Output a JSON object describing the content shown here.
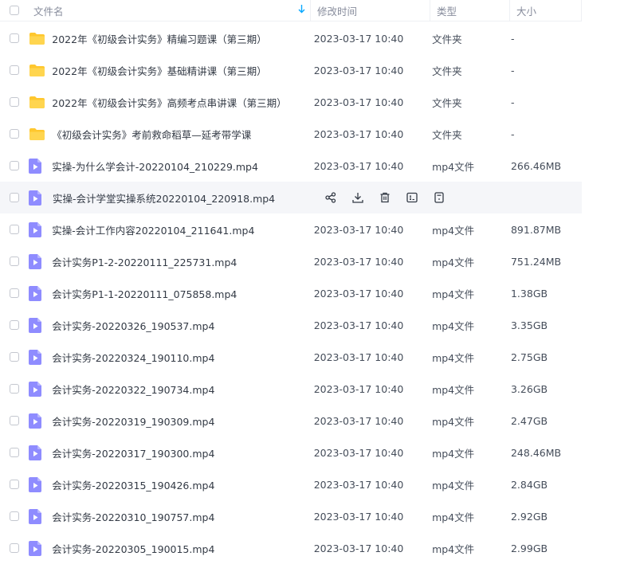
{
  "header": {
    "name": "文件名",
    "sort_icon": "sort-down-arrow-icon",
    "time": "修改时间",
    "type": "类型",
    "size": "大小"
  },
  "colors": {
    "accent": "#06a7ff",
    "folder": "#ffc72e",
    "video": "#8f8cff",
    "hover_bg": "#f5f6f9"
  },
  "rows": [
    {
      "kind": "folder",
      "name": "2022年《初级会计实务》精编习题课（第三期）",
      "time": "2023-03-17 10:40",
      "type": "文件夹",
      "size": "-"
    },
    {
      "kind": "folder",
      "name": "2022年《初级会计实务》基础精讲课（第三期）",
      "time": "2023-03-17 10:40",
      "type": "文件夹",
      "size": "-"
    },
    {
      "kind": "folder",
      "name": "2022年《初级会计实务》高频考点串讲课（第三期）",
      "time": "2023-03-17 10:40",
      "type": "文件夹",
      "size": "-"
    },
    {
      "kind": "folder",
      "name": "《初级会计实务》考前救命稻草—延考带学课",
      "time": "2023-03-17 10:40",
      "type": "文件夹",
      "size": "-"
    },
    {
      "kind": "video",
      "name": "实操-为什么学会计-20220104_210229.mp4",
      "time": "2023-03-17 10:40",
      "type": "mp4文件",
      "size": "266.46MB"
    },
    {
      "kind": "video",
      "name": "实操-会计学堂实操系统20220104_220918.mp4",
      "hover": true,
      "actions": [
        "share-icon",
        "download-icon",
        "delete-icon",
        "rename-icon",
        "more-icon"
      ]
    },
    {
      "kind": "video",
      "name": "实操-会计工作内容20220104_211641.mp4",
      "time": "2023-03-17 10:40",
      "type": "mp4文件",
      "size": "891.87MB"
    },
    {
      "kind": "video",
      "name": "会计实务P1-2-20220111_225731.mp4",
      "time": "2023-03-17 10:40",
      "type": "mp4文件",
      "size": "751.24MB"
    },
    {
      "kind": "video",
      "name": "会计实务P1-1-20220111_075858.mp4",
      "time": "2023-03-17 10:40",
      "type": "mp4文件",
      "size": "1.38GB"
    },
    {
      "kind": "video",
      "name": "会计实务-20220326_190537.mp4",
      "time": "2023-03-17 10:40",
      "type": "mp4文件",
      "size": "3.35GB"
    },
    {
      "kind": "video",
      "name": "会计实务-20220324_190110.mp4",
      "time": "2023-03-17 10:40",
      "type": "mp4文件",
      "size": "2.75GB"
    },
    {
      "kind": "video",
      "name": "会计实务-20220322_190734.mp4",
      "time": "2023-03-17 10:40",
      "type": "mp4文件",
      "size": "3.26GB"
    },
    {
      "kind": "video",
      "name": "会计实务-20220319_190309.mp4",
      "time": "2023-03-17 10:40",
      "type": "mp4文件",
      "size": "2.47GB"
    },
    {
      "kind": "video",
      "name": "会计实务-20220317_190300.mp4",
      "time": "2023-03-17 10:40",
      "type": "mp4文件",
      "size": "248.46MB"
    },
    {
      "kind": "video",
      "name": "会计实务-20220315_190426.mp4",
      "time": "2023-03-17 10:40",
      "type": "mp4文件",
      "size": "2.84GB"
    },
    {
      "kind": "video",
      "name": "会计实务-20220310_190757.mp4",
      "time": "2023-03-17 10:40",
      "type": "mp4文件",
      "size": "2.92GB"
    },
    {
      "kind": "video",
      "name": "会计实务-20220305_190015.mp4",
      "time": "2023-03-17 10:40",
      "type": "mp4文件",
      "size": "2.99GB"
    }
  ]
}
